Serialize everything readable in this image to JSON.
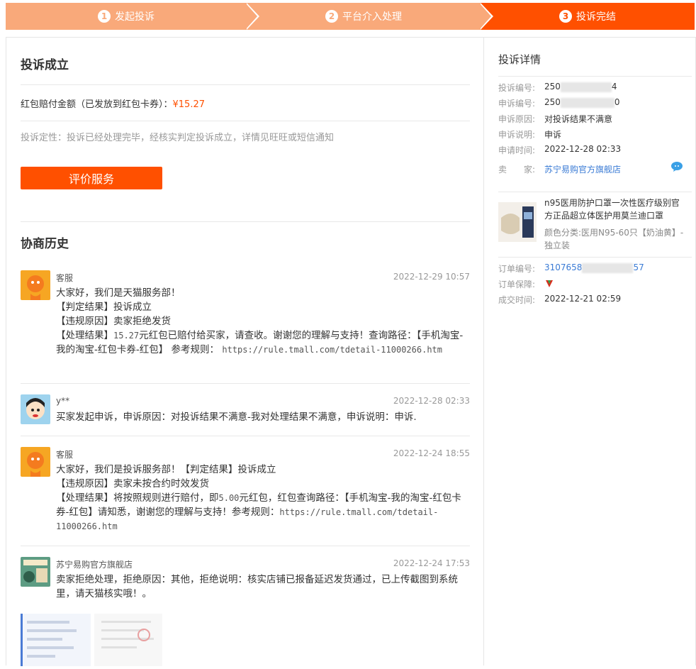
{
  "steps": [
    {
      "num": "1",
      "label": "发起投诉"
    },
    {
      "num": "2",
      "label": "平台介入处理"
    },
    {
      "num": "3",
      "label": "投诉完结"
    }
  ],
  "result": {
    "title": "投诉成立",
    "refund_label": "红包赔付金额（已发放到红包卡券）：",
    "refund_amount": "¥15.27",
    "nature_text": "投诉定性：投诉已经处理完毕，经核实判定投诉成立，详情见旺旺或短信通知",
    "rate_button": "评价服务"
  },
  "history": {
    "title": "协商历史",
    "messages": [
      {
        "name": "客服",
        "time": "2022-12-29 10:57",
        "lines": [
          "大家好，我们是天猫服务部！",
          "【判定结果】投诉成立",
          "【违规原因】卖家拒绝发货"
        ],
        "line4_prefix": "【处理结果】",
        "line4_amount": "15.27",
        "line4_text": "元红包已赔付给买家，请查收。谢谢您的理解与支持！查询路径：【手机淘宝-我的淘宝-红包卡券-红包】 参考规则：",
        "line4_url": "https://rule.tmall.com/tdetail-11000266.htm"
      },
      {
        "name": "y**",
        "time": "2022-12-28 02:33",
        "text": "买家发起申诉，申诉原因：对投诉结果不满意-我对处理结果不满意，申诉说明：申诉."
      },
      {
        "name": "客服",
        "time": "2022-12-24 18:55",
        "lines": [
          "大家好，我们是投诉服务部！【判定结果】投诉成立",
          "【违规原因】卖家未按合约时效发货"
        ],
        "line3_prefix": "【处理结果】将按照规则进行赔付，即",
        "line3_amount": "5.00",
        "line3_text": "元红包，红包查询路径：【手机淘宝-我的淘宝-红包卡券-红包】请知悉，谢谢您的理解与支持！参考规则：",
        "line3_url": "https://rule.tmall.com/tdetail-11000266.htm"
      },
      {
        "name": "苏宁易购官方旗舰店",
        "time": "2022-12-24 17:53",
        "text": "卖家拒绝处理，拒绝原因：其他，拒绝说明：核实店铺已报备延迟发货通过，已上传截图到系统里，请天猫核实哦！。"
      }
    ]
  },
  "details": {
    "title": "投诉详情",
    "complaint_no_label": "投诉编号:",
    "complaint_no_prefix": "250",
    "complaint_no_suffix": "4",
    "appeal_no_label": "申诉编号:",
    "appeal_no_prefix": "250",
    "appeal_no_suffix": "0",
    "appeal_reason_label": "申诉原因:",
    "appeal_reason": "对投诉结果不满意",
    "appeal_desc_label": "申诉说明:",
    "appeal_desc": "申诉",
    "apply_time_label": "申请时间:",
    "apply_time": "2022-12-28 02:33",
    "seller_label": "卖　　家:",
    "seller": "苏宁易购官方旗舰店",
    "product_title": "n95医用防护口罩一次性医疗级别官方正品超立体医护用莫兰迪口罩",
    "product_spec": "颜色分类:医用N95-60只【奶油黄】-独立装",
    "order_no_label": "订单编号:",
    "order_no_prefix": "3107658",
    "order_no_suffix": "57",
    "order_guarantee_label": "订单保障:",
    "deal_time_label": "成交时间:",
    "deal_time": "2022-12-21 02:59"
  },
  "colors": {
    "accent": "#ff5000",
    "step_inactive": "#f9a97a",
    "link": "#3a7bd5"
  }
}
